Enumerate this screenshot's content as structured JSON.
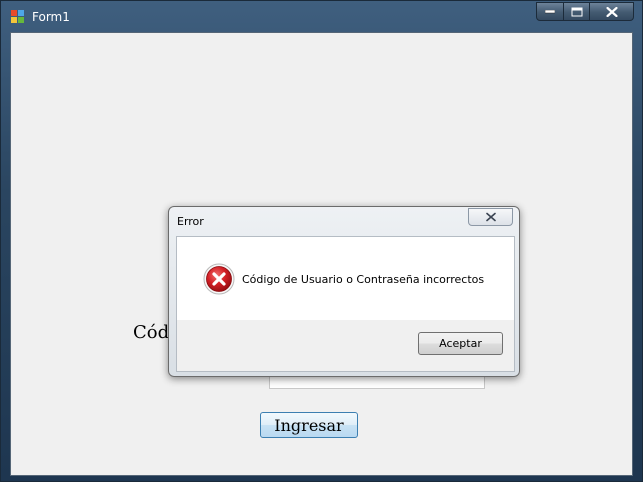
{
  "window": {
    "title": "Form1",
    "icon": "form-app-icon",
    "caption_icons": {
      "minimize": "minimize-icon",
      "maximize": "maximize-icon",
      "close": "close-icon"
    }
  },
  "form": {
    "code_label": "Códi",
    "password_mask": "•••",
    "login_button": "Ingresar"
  },
  "dialog": {
    "title": "Error",
    "icon": "error-icon",
    "message": "Código de Usuario o Contraseña incorrectos",
    "ok_button": "Aceptar",
    "colors": {
      "error_red": "#c8141b",
      "button_border": "#3c7fb1"
    }
  }
}
